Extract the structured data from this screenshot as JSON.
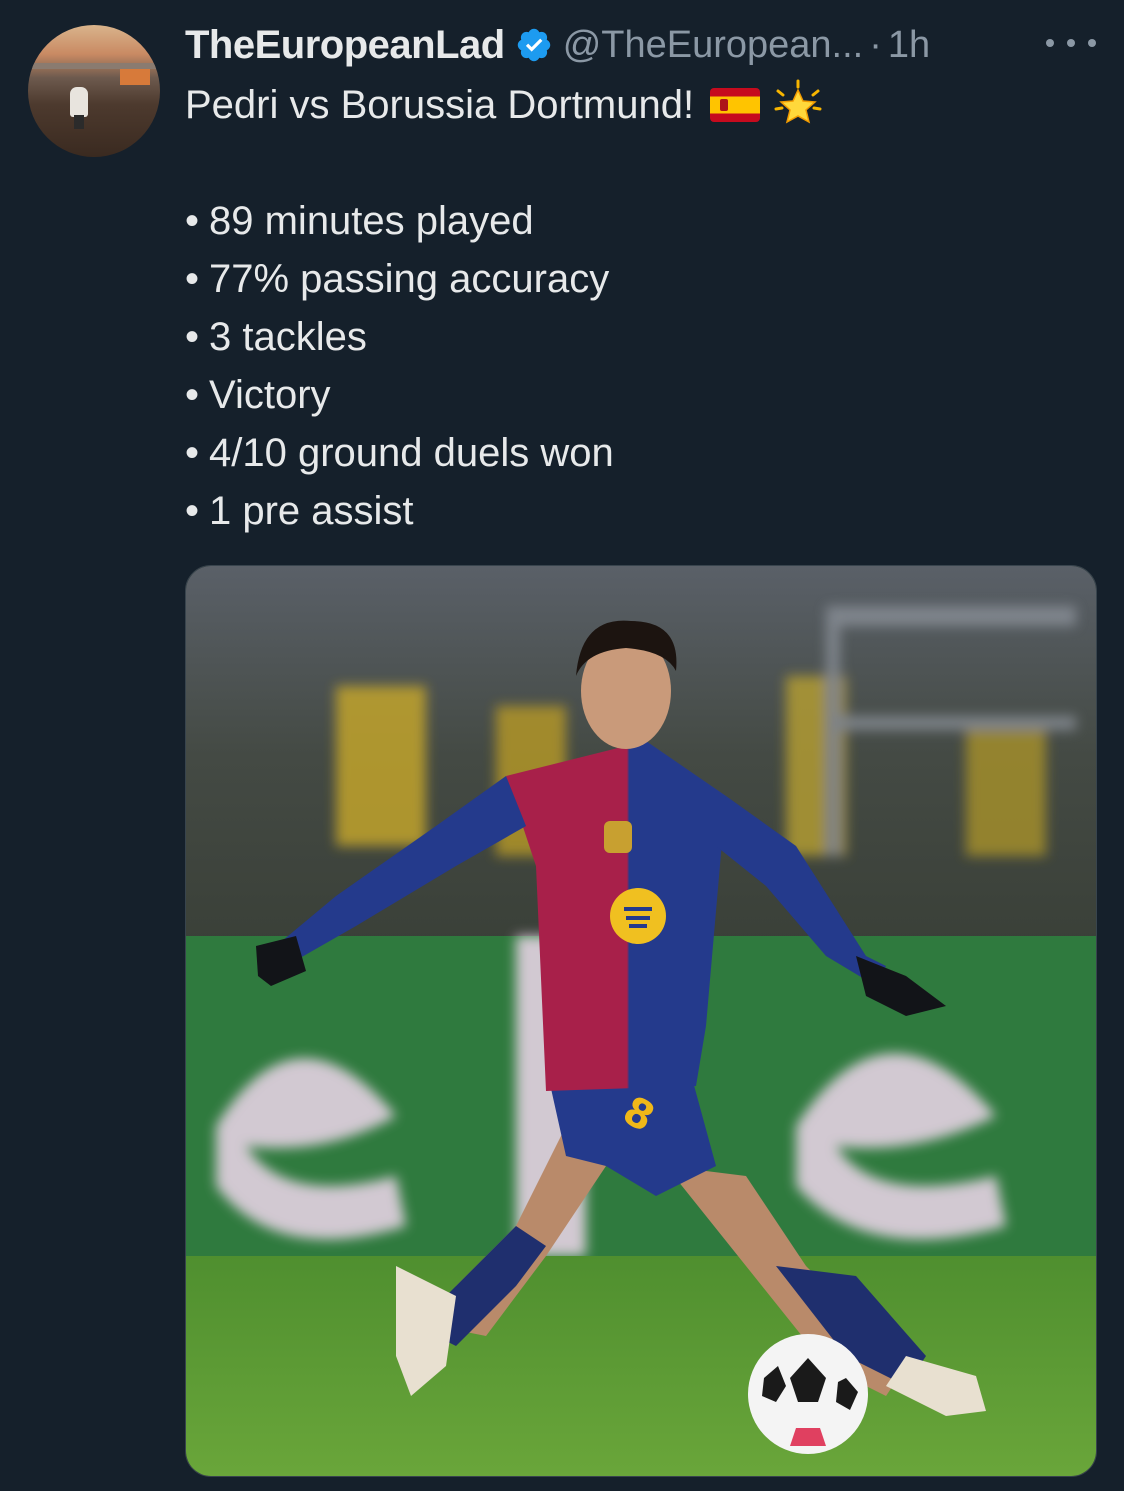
{
  "author": {
    "display_name": "TheEuropeanLad",
    "handle": "@TheEuropean...",
    "separator": "·",
    "time": "1h",
    "verified": true,
    "verified_color": "#1d9bf0"
  },
  "menu": {
    "icon": "more-horizontal-icon"
  },
  "tweet": {
    "headline": "Pedri vs Borussia Dortmund!",
    "emojis": [
      "spain-flag-icon",
      "glowing-star-icon"
    ],
    "stats": [
      "89 minutes played",
      "77% passing accuracy",
      "3 tackles",
      "Victory",
      "4/10 ground duels won",
      "1 pre assist"
    ],
    "bullet": "•"
  },
  "media": {
    "kind": "photo",
    "jersey_number": "8"
  },
  "colors": {
    "background": "#15202b",
    "text_primary": "#e7e9ea",
    "text_secondary": "#8b98a5",
    "accent": "#1d9bf0"
  }
}
